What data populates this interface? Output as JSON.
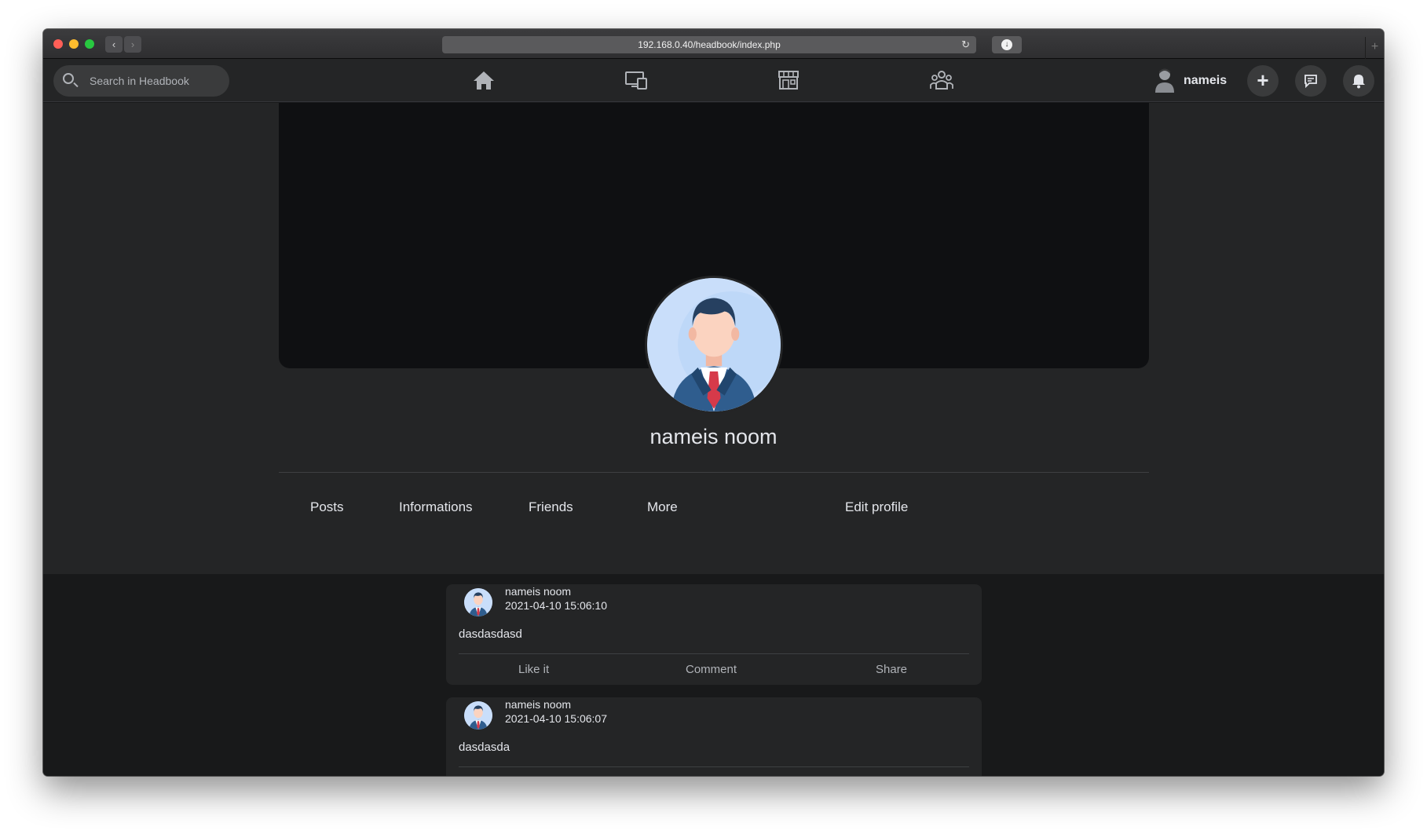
{
  "browser": {
    "url": "192.168.0.40/headbook/index.php",
    "back_glyph": "‹",
    "forward_glyph": "›",
    "reload_glyph": "↻",
    "download_glyph": "↓",
    "newtab_glyph": "+"
  },
  "navbar": {
    "search_placeholder": "Search in Headbook",
    "icons": [
      "home-icon",
      "watch-icon",
      "marketplace-icon",
      "groups-icon"
    ],
    "username": "nameis",
    "plus_glyph": "+"
  },
  "profile": {
    "name": "nameis noom",
    "tabs": {
      "posts": "Posts",
      "informations": "Informations",
      "friends": "Friends",
      "more": "More",
      "edit": "Edit profile"
    }
  },
  "posts": [
    {
      "author": "nameis noom",
      "date": "2021-04-10 15:06:10",
      "text": "dasdasdasd",
      "actions": {
        "like": "Like it",
        "comment": "Comment",
        "share": "Share"
      }
    },
    {
      "author": "nameis noom",
      "date": "2021-04-10 15:06:07",
      "text": "dasdasda"
    }
  ],
  "colors": {
    "page_bg": "#18191a",
    "card_bg": "#242526",
    "text": "#e4e6eb",
    "muted": "#b0b3b8"
  }
}
